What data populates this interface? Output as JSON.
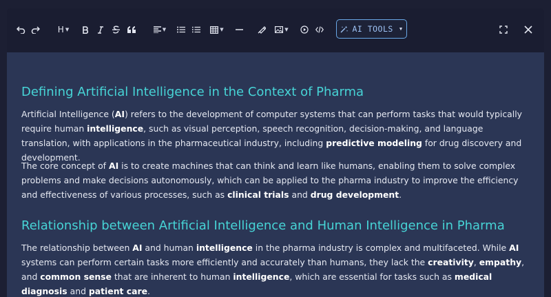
{
  "toolbar": {
    "heading_label": "H",
    "ai_tools_label": "AI TOOLS"
  },
  "document": {
    "section1": {
      "heading": "Defining Artificial Intelligence in the Context of Pharma",
      "para1": {
        "t1": "Artificial Intelligence (",
        "b1": "AI",
        "t2": ") refers to the development of computer systems that can perform tasks that would typically require human ",
        "b2": "intelligence",
        "t3": ", such as visual perception, speech recognition, decision-making, and language translation, with applications in the pharmaceutical industry, including ",
        "b3": "predictive modeling",
        "t4": " for drug discovery and development."
      },
      "para2": {
        "t1": "The core concept of ",
        "b1": "AI",
        "t2": " is to create machines that can think and learn like humans, enabling them to solve complex problems and make decisions autonomously, which can be applied to the pharma industry to improve the efficiency and effectiveness of various processes, such as ",
        "b2": "clinical trials",
        "t3": " and ",
        "b3": "drug development",
        "t4": "."
      }
    },
    "section2": {
      "heading": "Relationship between Artificial Intelligence and Human Intelligence in Pharma",
      "para1": {
        "t1": "The relationship between ",
        "b1": "AI",
        "t2": " and human ",
        "b2": "intelligence",
        "t3": " in the pharma industry is complex and multifaceted. While ",
        "b3": "AI",
        "t4": " systems can perform certain tasks more efficiently and accurately than humans, they lack the ",
        "b4": "creativity",
        "t5": ", ",
        "b5": "empathy",
        "t6": ", and ",
        "b6": "common sense",
        "t7": " that are inherent to human ",
        "b7": "intelligence",
        "t8": ", which are essential for tasks such as ",
        "b8": "medical diagnosis",
        "t9": " and ",
        "b9": "patient care",
        "t10": "."
      }
    }
  },
  "colors": {
    "accent": "#47d4d6",
    "ai_border": "#6aa9e8",
    "doc_bg": "#2b3655",
    "toolbar_bg": "#1a1d31"
  }
}
